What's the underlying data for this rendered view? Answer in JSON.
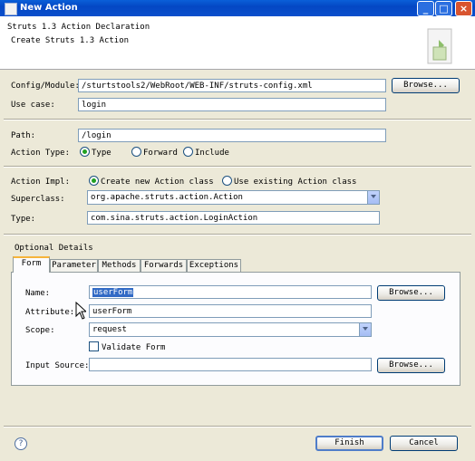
{
  "window": {
    "title": "New Action"
  },
  "banner": {
    "title": "Struts 1.3 Action Declaration",
    "subtitle": "Create Struts 1.3 Action"
  },
  "config": {
    "label": "Config/Module:",
    "value": "/sturtstools2/WebRoot/WEB-INF/struts-config.xml",
    "browse": "Browse..."
  },
  "usecase": {
    "label": "Use case:",
    "value": "login"
  },
  "path": {
    "label": "Path:",
    "value": "/login"
  },
  "actiontype": {
    "label": "Action Type:",
    "options": [
      "Type",
      "Forward",
      "Include"
    ],
    "selected": "Type"
  },
  "impl": {
    "label": "Action Impl:",
    "options": [
      "Create new Action class",
      "Use existing Action class"
    ],
    "selected": "Create new Action class"
  },
  "superclass": {
    "label": "Superclass:",
    "value": "org.apache.struts.action.Action"
  },
  "type": {
    "label": "Type:",
    "value": "com.sina.struts.action.LoginAction"
  },
  "optional": {
    "label": "Optional Details",
    "tabs": [
      "Form",
      "Parameter",
      "Methods",
      "Forwards",
      "Exceptions"
    ],
    "active_tab": "Form",
    "form": {
      "name_label": "Name:",
      "name_value": "userForm",
      "name_browse": "Browse...",
      "attribute_label": "Attribute:",
      "attribute_value": "userForm",
      "scope_label": "Scope:",
      "scope_value": "request",
      "validate_label": "Validate Form",
      "input_label": "Input Source:",
      "input_value": "",
      "input_browse": "Browse..."
    }
  },
  "footer": {
    "finish": "Finish",
    "cancel": "Cancel",
    "help_icon": "?"
  },
  "colors": {
    "titlebar": "#0447c4",
    "selection": "#316ac5",
    "tab_accent": "#f6b43b"
  }
}
